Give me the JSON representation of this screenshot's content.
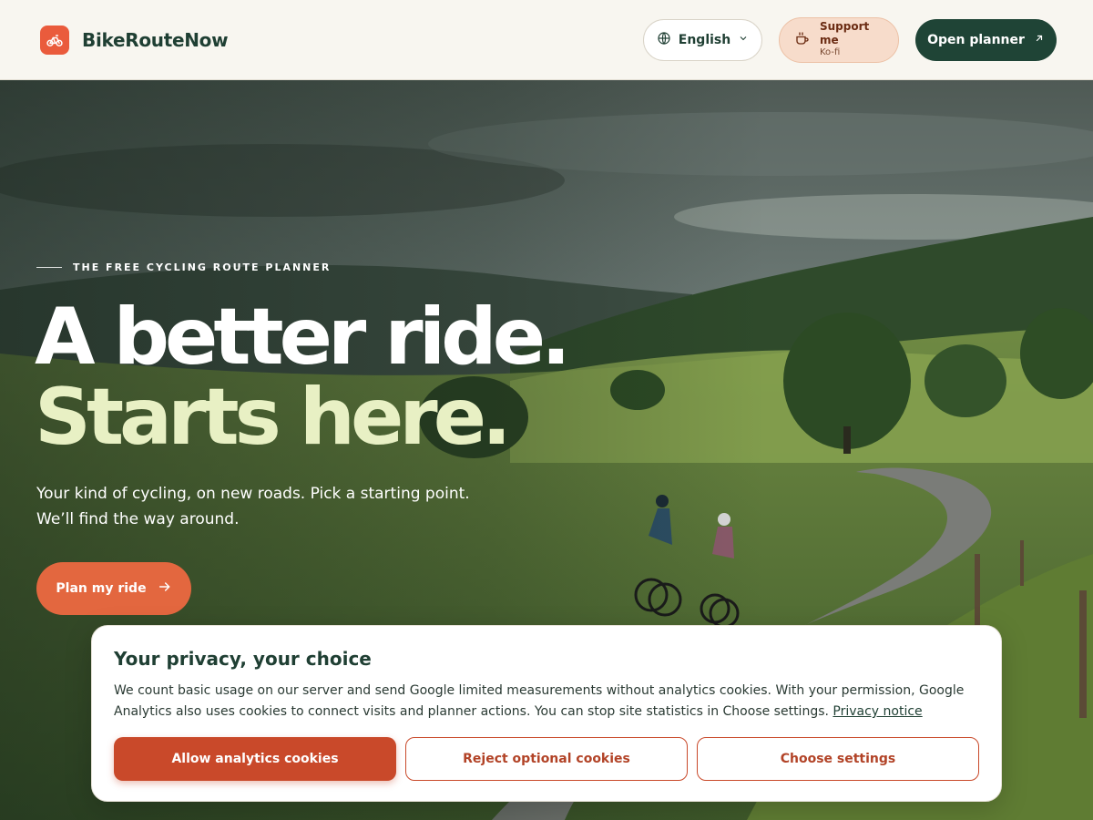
{
  "header": {
    "brand": "BikeRouteNow",
    "language_label": "English",
    "support_title": "Support me",
    "support_sub": "Ko-fi",
    "planner_label": "Open planner"
  },
  "hero": {
    "eyebrow": "THE FREE CYCLING ROUTE PLANNER",
    "headline_line1": "A better ride.",
    "headline_line2": "Starts here.",
    "subcopy_line1": "Your kind of cycling, on new roads. Pick a starting point.",
    "subcopy_line2": "We’ll find the way around.",
    "cta_label": "Plan my ride"
  },
  "cookie": {
    "title": "Your privacy, your choice",
    "body": "We count basic usage on our server and send Google limited measurements without analytics cookies. With your permission, Google Analytics also uses cookies to connect visits and planner actions. You can stop site statistics in Choose settings.",
    "privacy_link": "Privacy notice",
    "allow_label": "Allow analytics cookies",
    "reject_label": "Reject optional cookies",
    "settings_label": "Choose settings"
  },
  "colors": {
    "brand_orange": "#ea5b3c",
    "dark_green": "#1f4436",
    "headline_accent": "#e8f0c4",
    "cookie_primary": "#c9492a"
  },
  "icons": {
    "logo": "bicycle-icon",
    "language": "globe-icon",
    "language_caret": "chevron-down-icon",
    "support": "coffee-cup-icon",
    "planner": "arrow-up-right-icon",
    "cta": "arrow-right-icon"
  }
}
